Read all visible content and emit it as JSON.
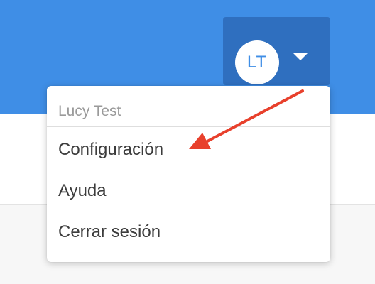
{
  "header": {
    "avatar_initials": "LT",
    "caret_icon": "caret-down-icon"
  },
  "user_menu": {
    "user_name": "Lucy Test",
    "items": [
      {
        "label": "Configuración"
      },
      {
        "label": "Ayuda"
      },
      {
        "label": "Cerrar sesión"
      }
    ]
  },
  "annotation": {
    "arrow_color": "#e8402c"
  },
  "colors": {
    "header_blue": "#3f8ee6",
    "toggle_blue": "#2f6fbf"
  }
}
